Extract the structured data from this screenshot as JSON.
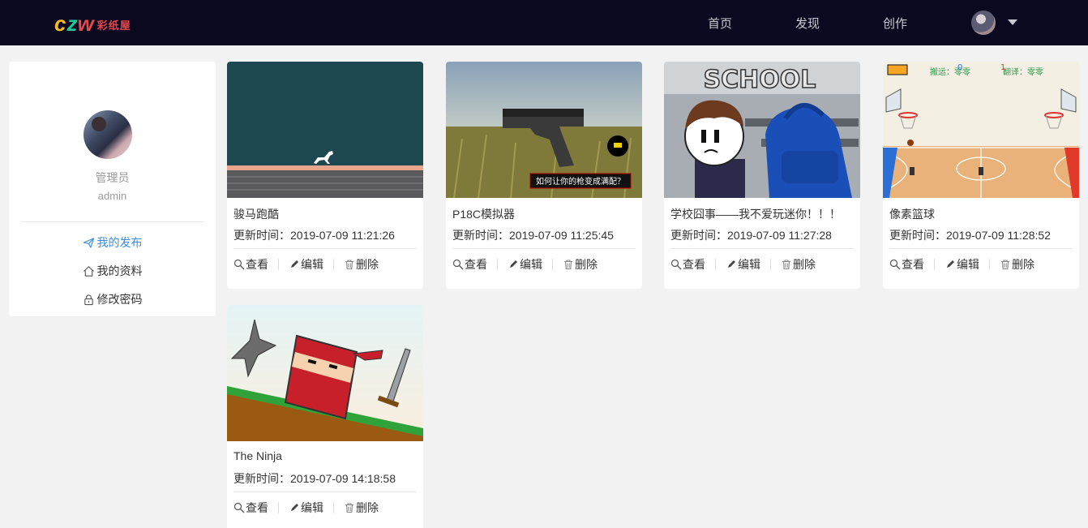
{
  "brand": {
    "logo_c": "c",
    "logo_z": "z",
    "logo_w": "w",
    "logo_text": "彩纸屋"
  },
  "nav": {
    "home": "首页",
    "discover": "发现",
    "create": "创作"
  },
  "sidebar": {
    "role": "管理员",
    "username": "admin",
    "items": [
      {
        "label": "我的发布",
        "icon": "paper-plane-icon",
        "active": true
      },
      {
        "label": "我的资料",
        "icon": "home-icon",
        "active": false
      },
      {
        "label": "修改密码",
        "icon": "lock-icon",
        "active": false
      }
    ]
  },
  "labels": {
    "time_prefix": "更新时间：",
    "view": "查看",
    "edit": "编辑",
    "delete": "删除"
  },
  "cards": [
    {
      "title": "骏马跑酷",
      "time": "2019-07-09 11:21:26"
    },
    {
      "title": "P18C模拟器",
      "time": "2019-07-09 11:25:45",
      "image_caption": "如何让你的枪变成满配？"
    },
    {
      "title": "学校囧事——我不爱玩迷你！！！",
      "time": "2019-07-09 11:27:28",
      "image_caption": "SCHOOL"
    },
    {
      "title": "像素篮球",
      "time": "2019-07-09 11:28:52",
      "image_hud_left": "搬运：零零",
      "image_hud_right": "翻译：零零",
      "image_score_left": "0",
      "image_score_right": "1"
    },
    {
      "title": "The Ninja",
      "time": "2019-07-09 14:18:58"
    }
  ],
  "colors": {
    "nav_bg": "#0b0920",
    "accent": "#3a8ee6",
    "page_bg": "#f2f2f2"
  }
}
